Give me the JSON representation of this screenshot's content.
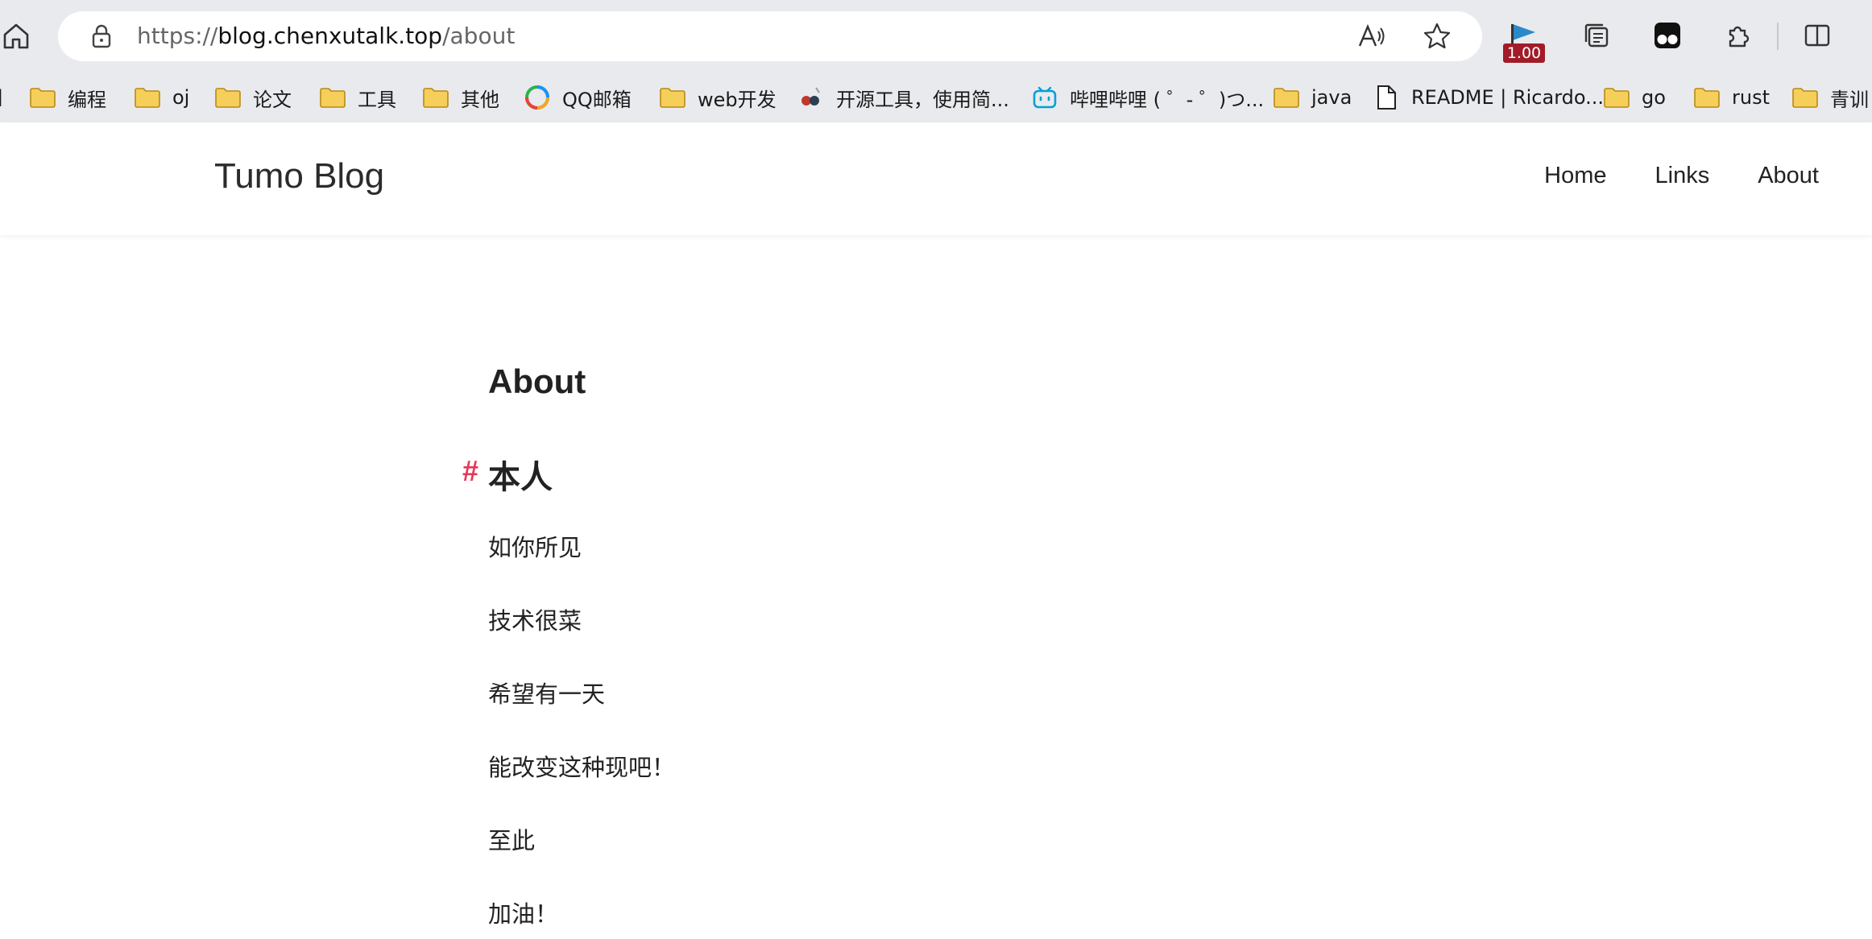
{
  "browser": {
    "url_scheme": "https://",
    "url_host": "blog.chenxutalk.top",
    "url_path": "/about",
    "extension_badge": "1.00",
    "bookmarks": [
      {
        "label": "编程",
        "icon": "folder-icon"
      },
      {
        "label": "oj",
        "icon": "folder-icon"
      },
      {
        "label": "论文",
        "icon": "folder-icon"
      },
      {
        "label": "工具",
        "icon": "folder-icon"
      },
      {
        "label": "其他",
        "icon": "folder-icon"
      },
      {
        "label": "QQ邮箱",
        "icon": "qq-mail-icon"
      },
      {
        "label": "web开发",
        "icon": "folder-icon"
      },
      {
        "label": "开源工具，使用简...",
        "icon": "site-icon"
      },
      {
        "label": "哔哩哔哩 ( ゜- ゜)つ...",
        "icon": "bilibili-icon"
      },
      {
        "label": "java",
        "icon": "folder-icon"
      },
      {
        "label": "README | Ricardo...",
        "icon": "page-icon"
      },
      {
        "label": "go",
        "icon": "folder-icon"
      },
      {
        "label": "rust",
        "icon": "folder-icon"
      },
      {
        "label": "青训",
        "icon": "folder-icon"
      }
    ]
  },
  "site": {
    "brand": "Tumo Blog",
    "nav": {
      "home": "Home",
      "links": "Links",
      "about": "About"
    }
  },
  "page": {
    "title": "About",
    "section": {
      "hash": "#",
      "heading": "本人"
    },
    "paragraphs": [
      "如你所见",
      "技术很菜",
      "希望有一天",
      "能改变这种现吧！",
      "至此",
      "加油！"
    ]
  },
  "colors": {
    "accent_hash": "#e53958",
    "chrome_bg": "#e9eaee",
    "folder_fill": "#f6cf5a"
  }
}
